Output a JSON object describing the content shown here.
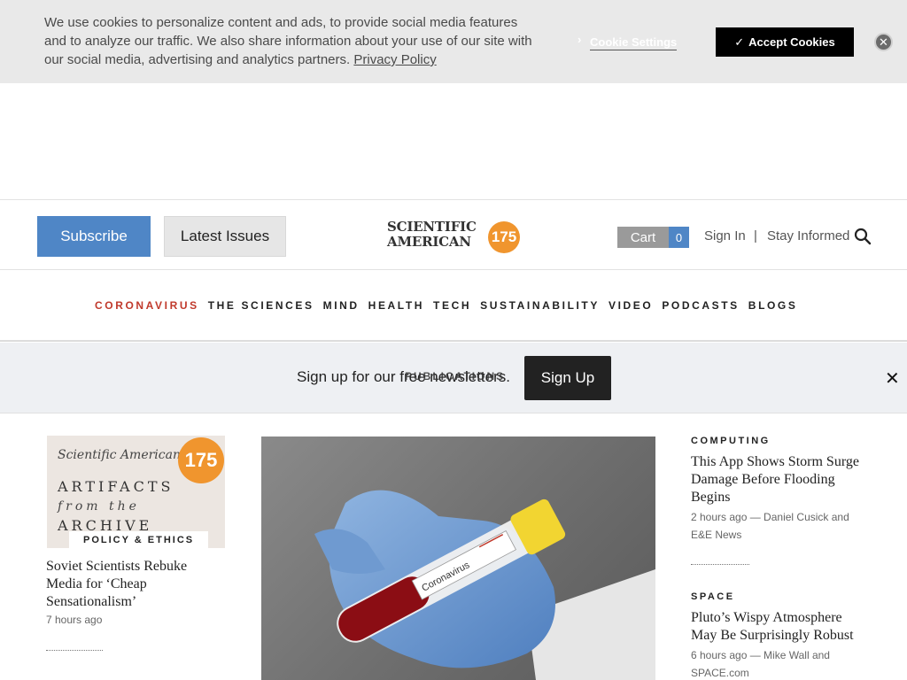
{
  "cookie": {
    "text": "We use cookies to personalize content and ads, to provide social media features and to analyze our traffic. We also share information about your use of our site with our social media, advertising and analytics partners.",
    "privacy_link": "Privacy Policy",
    "settings_label": "Cookie Settings",
    "accept_label": "Accept Cookies",
    "accept_check": "✓",
    "close_glyph": "✕"
  },
  "header": {
    "subscribe_label": "Subscribe",
    "latest_label": "Latest Issues",
    "logo_line1": "SCIENTIFIC",
    "logo_line2": "AMERICAN",
    "logo_badge": "175",
    "cart_label": "Cart",
    "cart_count": "0",
    "signin_label": "Sign In",
    "separator": "|",
    "stay_informed_label": "Stay Informed",
    "search_icon": "search-icon"
  },
  "nav": {
    "items": [
      "CORONAVIRUS",
      "THE SCIENCES",
      "MIND",
      "HEALTH",
      "TECH",
      "SUSTAINABILITY",
      "VIDEO",
      "PODCASTS",
      "BLOGS"
    ],
    "active_color": "#c0392b"
  },
  "newsletter": {
    "text": "Sign up for our free newsletters.",
    "overlay_label": "PUBLICATIONS",
    "signup_label": "Sign Up",
    "close_glyph": "✕"
  },
  "left_article": {
    "thumb": {
      "sa_text": "Scientific American.",
      "artifacts": "ARTIFACTS",
      "from_the": "from the",
      "archive": "ARCHIVE",
      "badge": "175"
    },
    "category": "POLICY & ETHICS",
    "title": "Soviet Scientists Rebuke Media for ‘Cheap Sensationalism’",
    "time": "7 hours ago"
  },
  "hero": {
    "tube_label": "Coronavirus"
  },
  "right_articles": [
    {
      "category": "COMPUTING",
      "title": "This App Shows Storm Surge Damage Before Flooding Begins",
      "meta": "2 hours ago — Daniel Cusick and E&E News"
    },
    {
      "category": "SPACE",
      "title": "Pluto’s Wispy Atmosphere May Be Surprisingly Robust",
      "meta": "6 hours ago — Mike Wall and SPACE.com"
    }
  ],
  "colors": {
    "subscribe_bg": "#4f86c6",
    "logo_badge": "#f0952e",
    "accept_bg": "#000000"
  }
}
